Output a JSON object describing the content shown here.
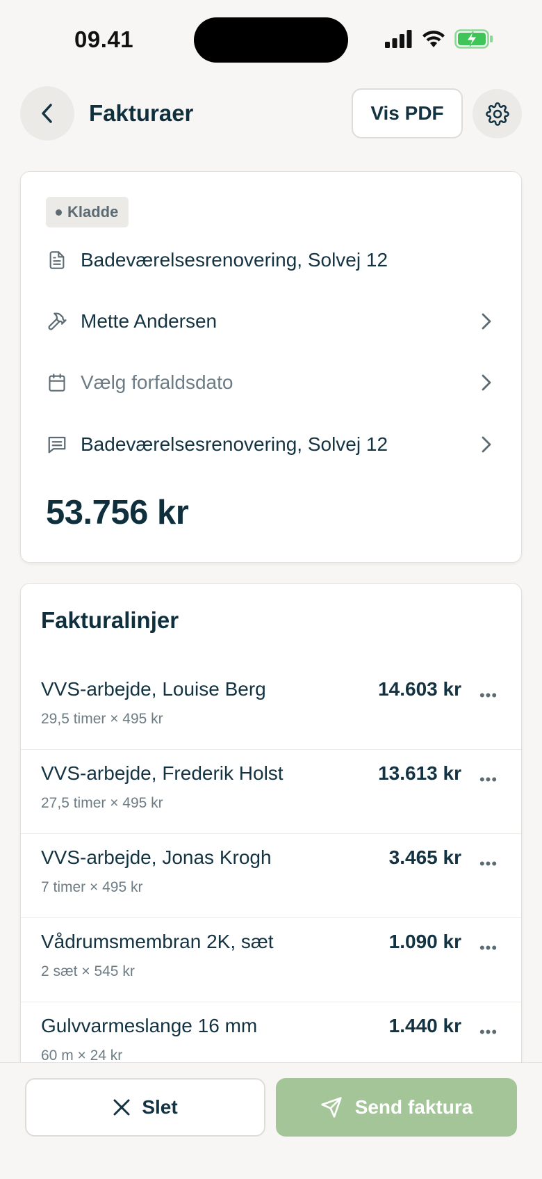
{
  "status_bar": {
    "time": "09.41"
  },
  "header": {
    "title": "Fakturaer",
    "pdf_label": "Vis PDF"
  },
  "invoice": {
    "status": "Kladde",
    "project": "Badeværelsesrenovering, Solvej 12",
    "customer": "Mette Andersen",
    "due_date_placeholder": "Vælg forfaldsdato",
    "description": "Badeværelsesrenovering, Solvej 12",
    "total": "53.756 kr"
  },
  "lines": {
    "title": "Fakturalinjer",
    "items": [
      {
        "name": "VVS-arbejde, Louise Berg",
        "detail": "29,5 timer × 495 kr",
        "amount": "14.603 kr"
      },
      {
        "name": "VVS-arbejde, Frederik Holst",
        "detail": "27,5 timer × 495 kr",
        "amount": "13.613 kr"
      },
      {
        "name": "VVS-arbejde, Jonas Krogh",
        "detail": "7 timer × 495 kr",
        "amount": "3.465 kr"
      },
      {
        "name": "Vådrumsmembran 2K, sæt",
        "detail": "2 sæt × 545 kr",
        "amount": "1.090 kr"
      },
      {
        "name": "Gulvvarmeslange 16 mm",
        "detail": "60 m × 24 kr",
        "amount": "1.440 kr"
      }
    ]
  },
  "actions": {
    "delete_label": "Slet",
    "send_label": "Send faktura"
  },
  "colors": {
    "accent_green": "#a3c597",
    "text_dark": "#0f2f3d",
    "battery_green": "#3fc45a"
  }
}
